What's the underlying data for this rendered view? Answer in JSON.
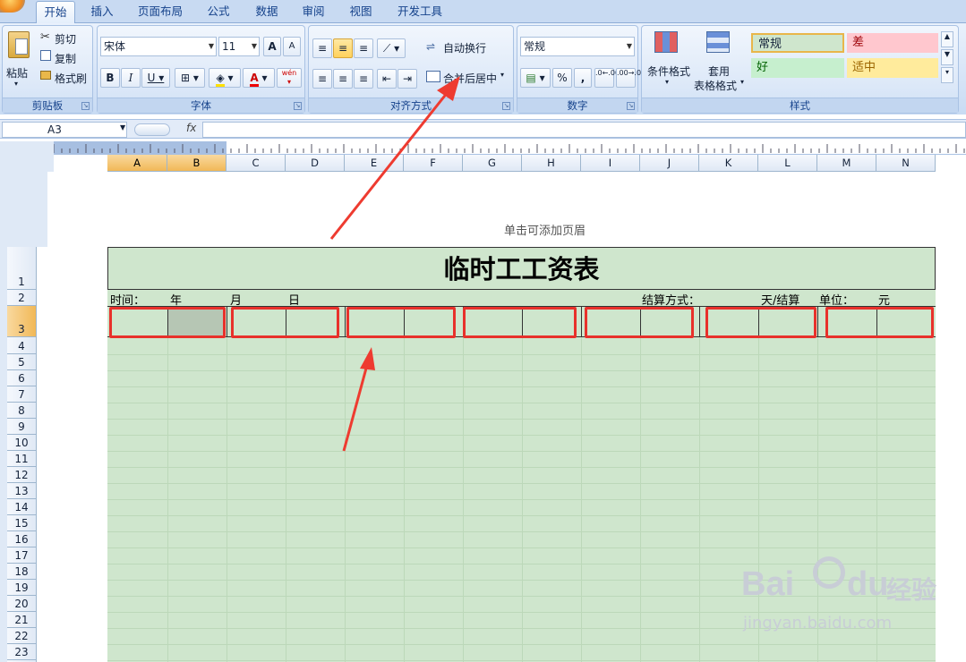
{
  "tabs": [
    "开始",
    "插入",
    "页面布局",
    "公式",
    "数据",
    "审阅",
    "视图",
    "开发工具"
  ],
  "active_tab": "开始",
  "clipboard": {
    "paste": "粘贴",
    "cut": "剪切",
    "copy": "复制",
    "format_painter": "格式刷",
    "group": "剪贴板"
  },
  "font": {
    "name": "宋体",
    "size": "11",
    "grow": "A",
    "shrink": "A",
    "bold": "B",
    "italic": "I",
    "underline": "U",
    "phonetic": "wén",
    "group": "字体"
  },
  "align": {
    "wrap": "自动换行",
    "merge": "合并后居中",
    "group": "对齐方式"
  },
  "number": {
    "format": "常规",
    "percent": "%",
    "comma": ",",
    "inc": ".0←.00",
    "dec": ".00→.0",
    "group": "数字"
  },
  "styles": {
    "conditional": "条件格式",
    "table": "套用",
    "table2": "表格格式",
    "normal": "常规",
    "bad": "差",
    "good": "好",
    "neutral": "适中",
    "group": "样式",
    "colors": {
      "normal": "#cfe6cd",
      "bad": "#ffc7ce",
      "good": "#cfe6cd",
      "neutral": "#ffeb9c"
    }
  },
  "formula_bar": {
    "name_box": "A3",
    "fx": "fx"
  },
  "columns": [
    "A",
    "B",
    "C",
    "D",
    "E",
    "F",
    "G",
    "H",
    "I",
    "J",
    "K",
    "L",
    "M",
    "N"
  ],
  "selected_columns": [
    "A",
    "B"
  ],
  "rows": [
    "1",
    "2",
    "3",
    "4",
    "5",
    "6",
    "7",
    "8",
    "9",
    "10",
    "11",
    "12",
    "13",
    "14",
    "15",
    "16",
    "17",
    "18",
    "19",
    "20",
    "21",
    "22",
    "23"
  ],
  "selected_row": "3",
  "page": {
    "header_hint": "单击可添加页眉"
  },
  "sheet": {
    "title": "临时工工资表",
    "row2": {
      "time": "时间：",
      "year": "年",
      "month": "月",
      "day": "日",
      "settle": "结算方式：",
      "per_day": "天/结算",
      "unit": "单位：",
      "yuan": "元"
    }
  },
  "watermark": {
    "brand": "Bai",
    "brand2": "du",
    "jingyan": "经验",
    "url": "jingyan.baidu.com"
  }
}
